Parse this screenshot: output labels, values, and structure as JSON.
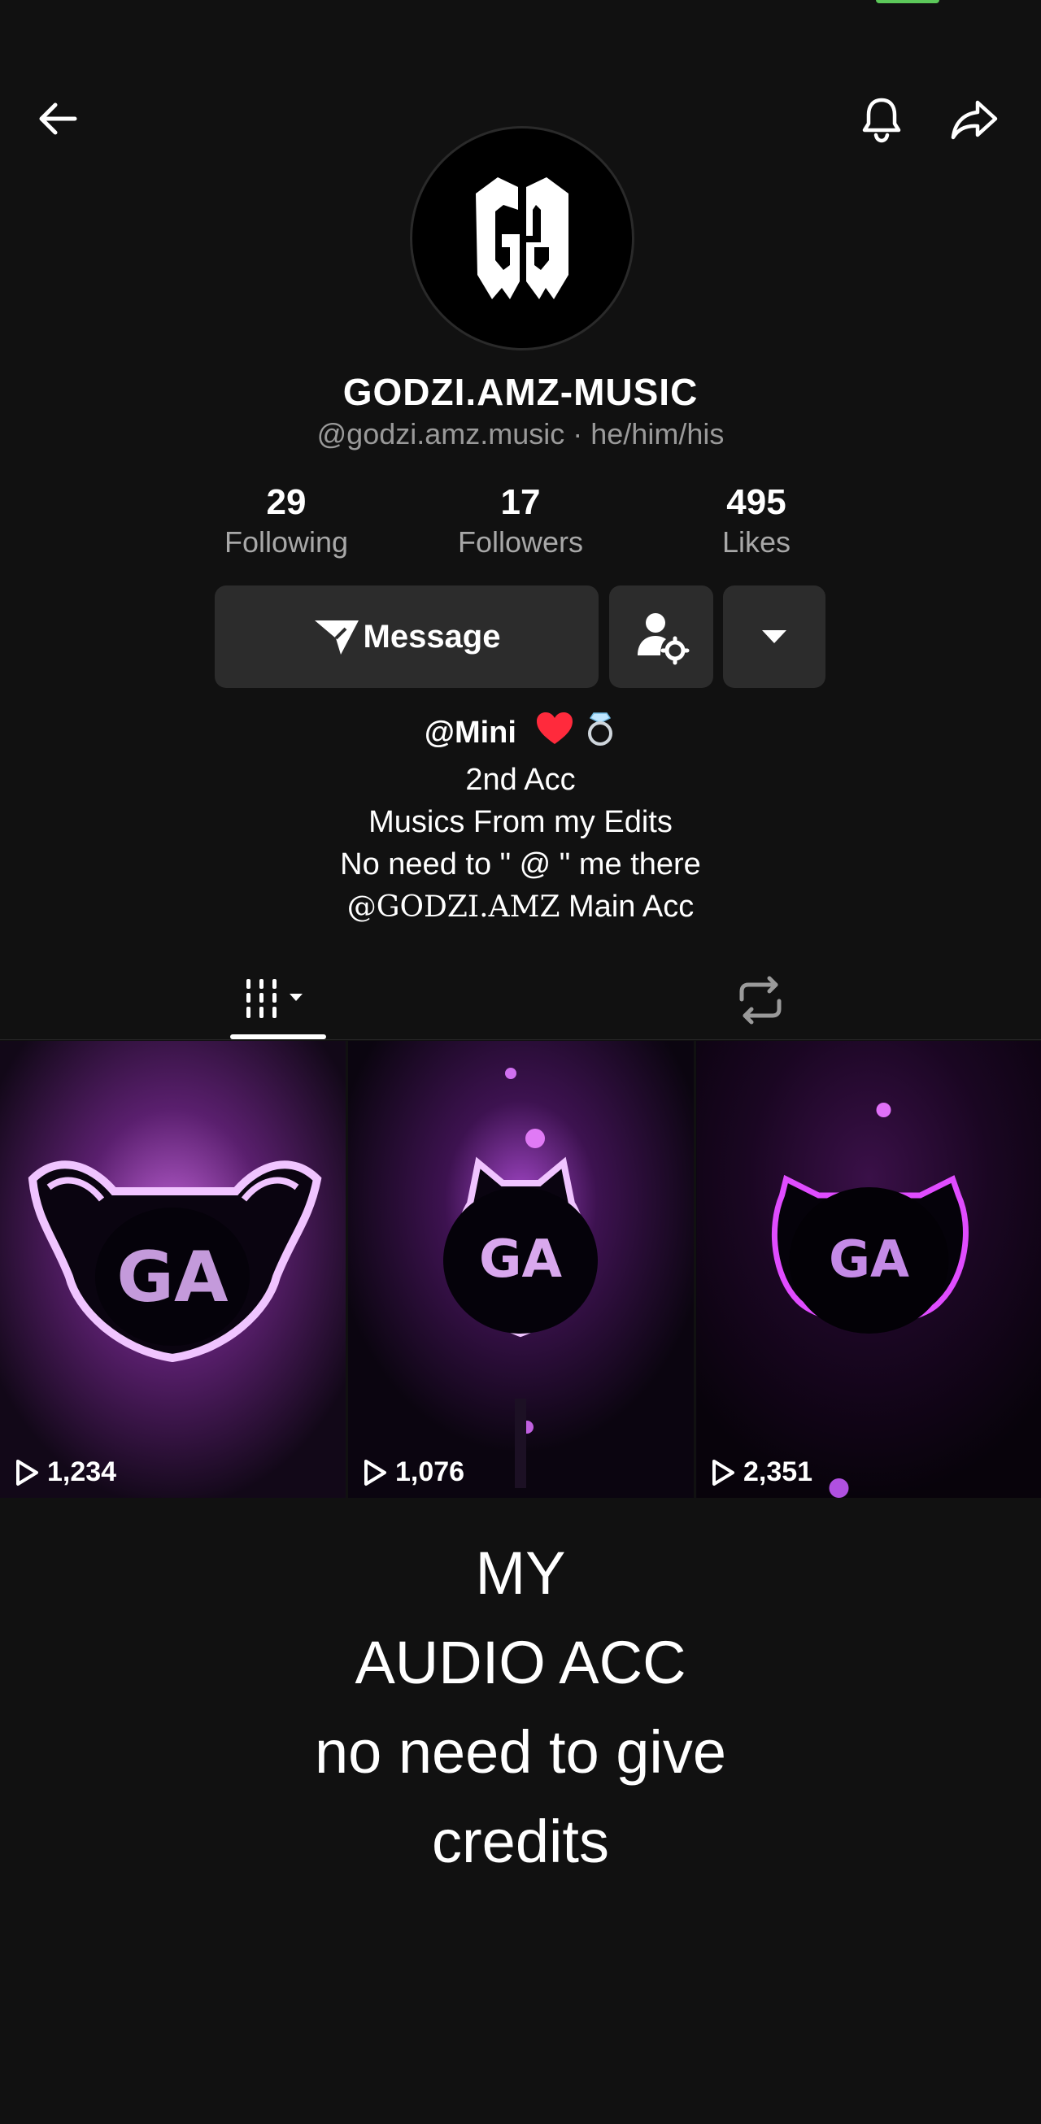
{
  "profile": {
    "display_name": "GODZI.AMZ-MUSIC",
    "handle_line": "@godzi.amz.music · he/him/his",
    "avatar_monogram": "GA"
  },
  "stats": [
    {
      "value": "29",
      "label": "Following"
    },
    {
      "value": "17",
      "label": "Followers"
    },
    {
      "value": "495",
      "label": "Likes"
    }
  ],
  "actions": {
    "message_label": "Message"
  },
  "bio": {
    "line1": "@Mini",
    "line2": "2nd Acc",
    "line3": "Musics From my Edits",
    "line4": "No need to \" @ \" me there",
    "line5_handle": "@GODZI.AMZ",
    "line5_rest": " Main Acc"
  },
  "videos": [
    {
      "views": "1,234"
    },
    {
      "views": "1,076"
    },
    {
      "views": "2,351"
    }
  ],
  "caption": {
    "line1": "MY",
    "line2": "AUDIO ACC",
    "line3": "no need to give",
    "line4": "credits"
  },
  "icons": {
    "back": "back-arrow-icon",
    "bell": "bell-icon",
    "share": "share-icon",
    "message": "paper-plane-icon",
    "add_friend": "add-friend-icon",
    "more": "dropdown-icon",
    "grid": "grid-tab-icon",
    "repost": "repost-icon",
    "play": "play-icon"
  },
  "colors": {
    "background": "#111111",
    "button": "#2c2c2c",
    "accent_purple": "#b44cf0",
    "heart": "#ff2a3c"
  }
}
